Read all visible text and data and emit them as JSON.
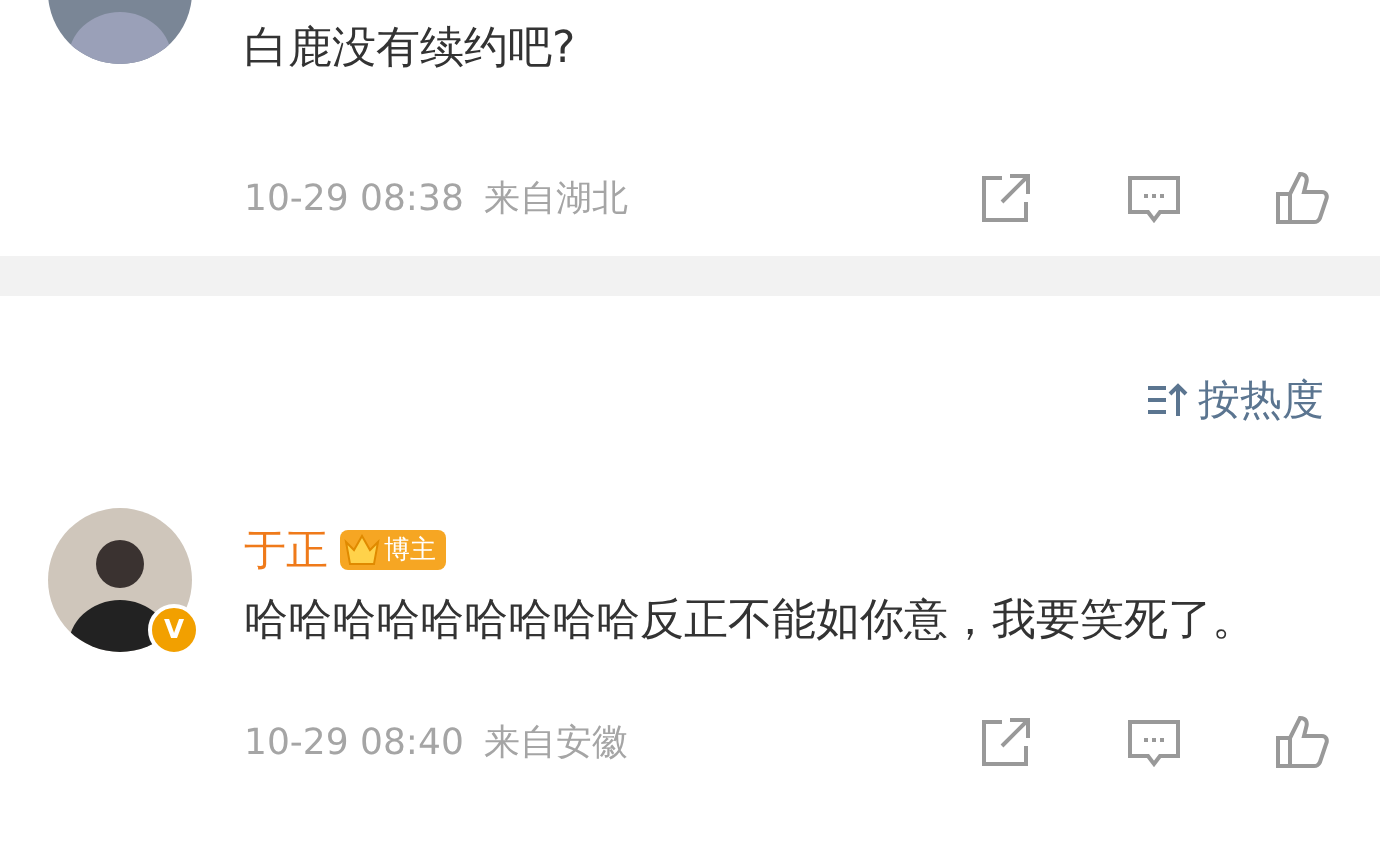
{
  "comments": [
    {
      "text": "白鹿没有续约吧?",
      "time": "10-29 08:38",
      "location": "来自湖北",
      "verified": false
    },
    {
      "author": "于正",
      "badge": "博主",
      "verified": true,
      "verified_mark": "V",
      "text": "哈哈哈哈哈哈哈哈哈反正不能如你意，我要笑死了。",
      "time": "10-29 08:40",
      "location": "来自安徽"
    }
  ],
  "sort": {
    "label": "按热度"
  }
}
